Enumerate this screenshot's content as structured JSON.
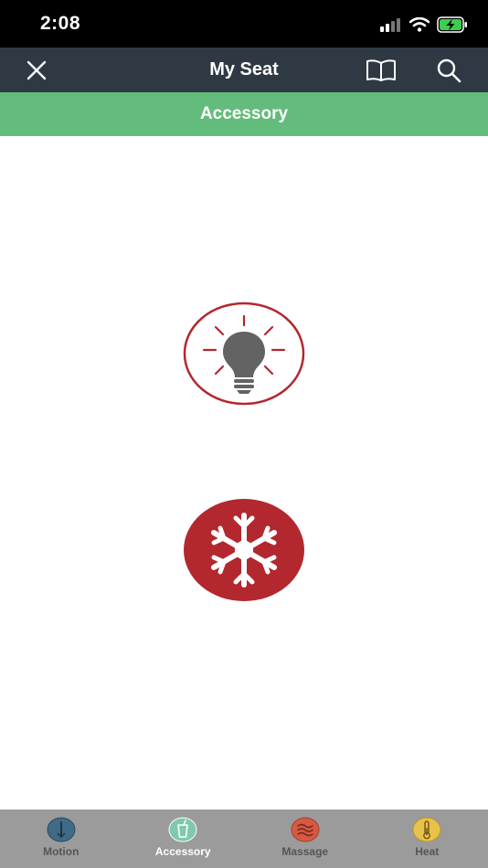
{
  "status_bar": {
    "time": "2:08"
  },
  "nav": {
    "title": "My Seat"
  },
  "section": {
    "title": "Accessory"
  },
  "accessories": [
    {
      "name": "light",
      "icon": "lightbulb-icon"
    },
    {
      "name": "climate",
      "icon": "snowflake-icon"
    }
  ],
  "tabs": [
    {
      "label": "Motion",
      "icon": "motion-icon",
      "active": false
    },
    {
      "label": "Accessory",
      "icon": "accessory-icon",
      "active": true
    },
    {
      "label": "Massage",
      "icon": "massage-icon",
      "active": false
    },
    {
      "label": "Heat",
      "icon": "heat-icon",
      "active": false
    }
  ],
  "colors": {
    "nav_bg": "#2f3943",
    "section_bg": "#63bc7c",
    "accent_red": "#b3272e",
    "tab_bar_bg": "#9b9b9b"
  }
}
